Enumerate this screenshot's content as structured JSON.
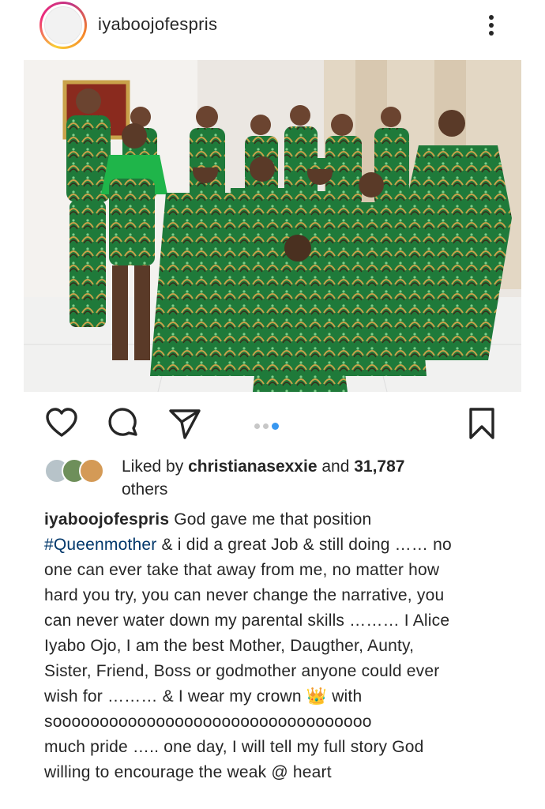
{
  "post": {
    "username": "iyaboojofespris",
    "more_icon": "more-vertical-icon"
  },
  "actions": {
    "like_icon": "heart-icon",
    "comment_icon": "comment-icon",
    "share_icon": "send-icon",
    "save_icon": "bookmark-icon",
    "carousel": {
      "count": 3,
      "active_index": 2
    }
  },
  "likes": {
    "prefix": "Liked by",
    "liker": "christianasexxie",
    "middle": "and",
    "count": "31,787",
    "suffix": "others"
  },
  "caption": {
    "user": "iyaboojofespris",
    "line1_text": "God gave me that position",
    "hashtag": "#Queenmother",
    "line2_text": "& i did a great Job & still doing …… no",
    "line3": "one can ever take that away from me, no matter how",
    "line4": "hard you try, you can never change the narrative, you",
    "line5": "can never water down my parental skills ……… I Alice",
    "line6": "Iyabo Ojo, I am the best Mother, Daugther, Aunty,",
    "line7": "Sister, Friend, Boss or godmother anyone could ever",
    "line8_before": "wish for ……… & I wear my crown",
    "crown_emoji": "👑",
    "line8_after": "with",
    "line9": "soooooooooooooooooooooooooooooooooo",
    "line10": "much pride ….. one day, I will tell my full story God",
    "line11": "willing to encourage the weak @ heart"
  },
  "colors": {
    "text": "#262626",
    "hashtag": "#00376b",
    "carousel_active": "#3897f0",
    "outfit_green": "#1f7a3a"
  }
}
